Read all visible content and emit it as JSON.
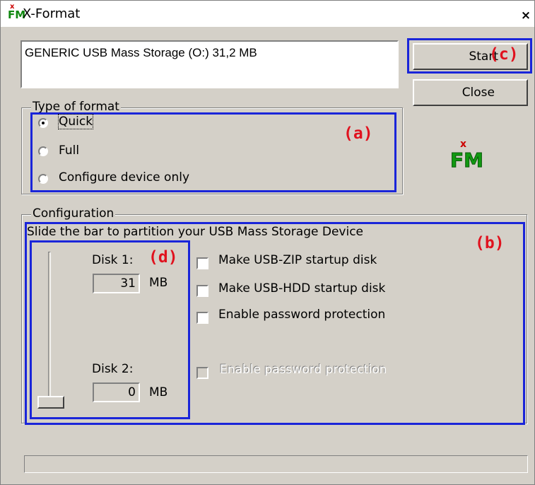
{
  "window": {
    "title": "X-Format",
    "close_glyph": "×",
    "app_icon_text": "FM"
  },
  "device": {
    "text": "GENERIC USB Mass Storage (O:)  31,2 MB"
  },
  "buttons": {
    "start": "Start",
    "close": "Close"
  },
  "annotations": {
    "a": "(a)",
    "b": "(b)",
    "c": "(c)",
    "d": "(d)",
    "highlight_color": "#1a25d9",
    "tag_color": "#e0121e"
  },
  "format_type": {
    "legend": "Type of format",
    "options": [
      {
        "label": "Quick",
        "selected": true
      },
      {
        "label": "Full",
        "selected": false
      },
      {
        "label": "Configure device only",
        "selected": false
      }
    ]
  },
  "configuration": {
    "legend": "Configuration",
    "instruction": "Slide the bar to partition your USB Mass Storage Device",
    "disk1": {
      "label": "Disk 1:",
      "value": "31",
      "unit": "MB"
    },
    "disk2": {
      "label": "Disk 2:",
      "value": "0",
      "unit": "MB"
    },
    "checkboxes": [
      {
        "label": "Make USB-ZIP startup disk",
        "checked": false,
        "enabled": true
      },
      {
        "label": "Make USB-HDD startup disk",
        "checked": false,
        "enabled": true
      },
      {
        "label": "Enable password protection",
        "checked": false,
        "enabled": true
      },
      {
        "label": "Enable password protection",
        "checked": false,
        "enabled": false
      }
    ],
    "slider_level": 0
  },
  "progress": {
    "value": 0
  },
  "logo": {
    "text": "FM",
    "accent": "x"
  }
}
